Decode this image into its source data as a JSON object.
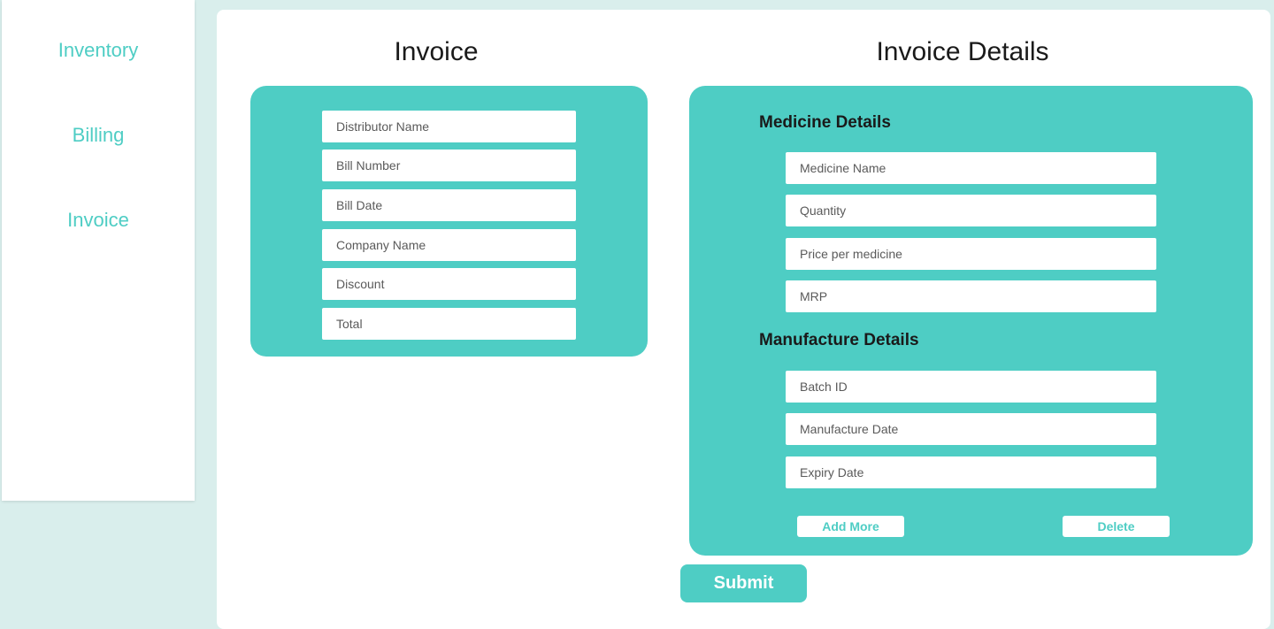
{
  "sidebar": {
    "items": [
      {
        "label": "Inventory"
      },
      {
        "label": "Billing"
      },
      {
        "label": "Invoice"
      }
    ]
  },
  "invoice": {
    "title": "Invoice",
    "fields": [
      {
        "placeholder": "Distributor Name"
      },
      {
        "placeholder": "Bill Number"
      },
      {
        "placeholder": "Bill Date"
      },
      {
        "placeholder": "Company Name"
      },
      {
        "placeholder": "Discount"
      },
      {
        "placeholder": "Total"
      }
    ]
  },
  "details": {
    "title": "Invoice Details",
    "medicine_heading": "Medicine Details",
    "medicine_fields": [
      {
        "placeholder": "Medicine Name"
      },
      {
        "placeholder": "Quantity"
      },
      {
        "placeholder": "Price per medicine"
      },
      {
        "placeholder": "MRP"
      }
    ],
    "manufacture_heading": "Manufacture Details",
    "manufacture_fields": [
      {
        "placeholder": "Batch ID"
      },
      {
        "placeholder": "Manufacture Date"
      },
      {
        "placeholder": "Expiry Date"
      }
    ],
    "add_more_label": "Add More",
    "delete_label": "Delete"
  },
  "submit_label": "Submit",
  "colors": {
    "accent": "#4ecdc4",
    "background": "#d9eeec"
  }
}
